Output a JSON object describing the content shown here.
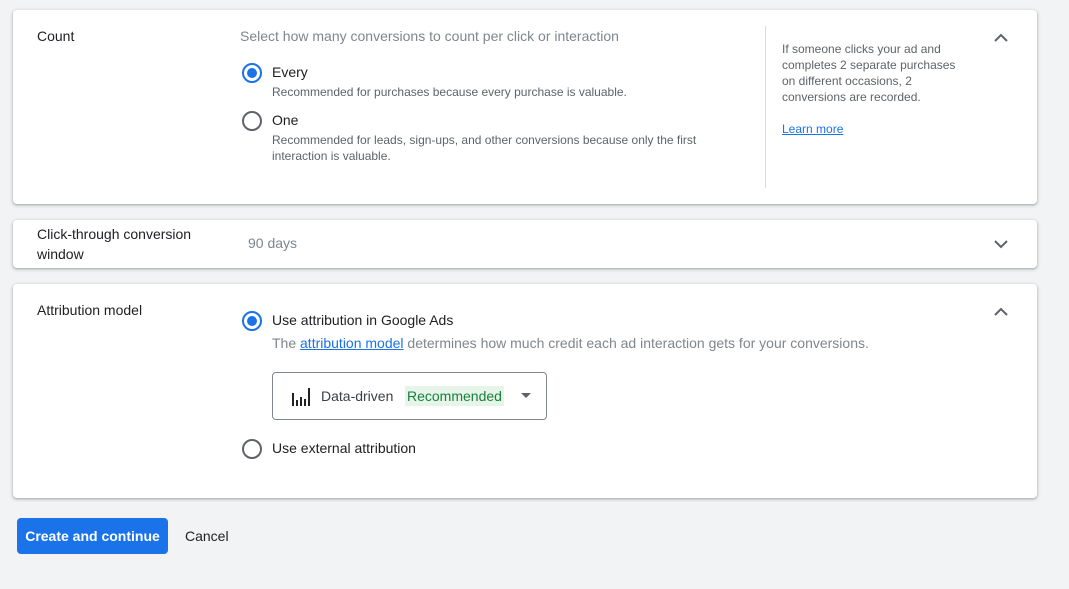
{
  "count": {
    "title": "Count",
    "subtitle": "Select how many conversions to count per click or interaction",
    "options": [
      {
        "label": "Every",
        "description": "Recommended for purchases because every purchase is valuable.",
        "selected": true
      },
      {
        "label": "One",
        "description_line1": "Recommended for leads, sign-ups, and other conversions because only the first",
        "description_line2": "interaction is valuable.",
        "selected": false
      }
    ],
    "help": {
      "line1": "If someone clicks your ad and",
      "line2": "completes 2 separate purchases",
      "line3": "on different occasions, 2",
      "line4": "conversions are recorded.",
      "link": "Learn more"
    },
    "chevron_icon": "chevron-up-icon"
  },
  "window": {
    "title_line1": "Click-through conversion",
    "title_line2": "window",
    "value": "90 days",
    "chevron_icon": "chevron-down-icon"
  },
  "attribution": {
    "title": "Attribution model",
    "option_google_ads": "Use attribution in Google Ads",
    "description_prefix": "The",
    "description_link": "attribution model",
    "description_suffix": "determines how much credit each ad interaction gets for your conversions.",
    "model": {
      "icon": "bar-chart-icon",
      "name": "Data-driven",
      "badge": "Recommended"
    },
    "option_external": "Use external attribution",
    "selected": "google_ads",
    "chevron_icon": "chevron-up-icon"
  },
  "actions": {
    "primary": "Create and continue",
    "cancel": "Cancel"
  },
  "colors": {
    "accent": "#1a73e8",
    "recommended_text": "#188038",
    "recommended_bg": "#e6f4ea",
    "page_bg": "#f1f3f4"
  }
}
